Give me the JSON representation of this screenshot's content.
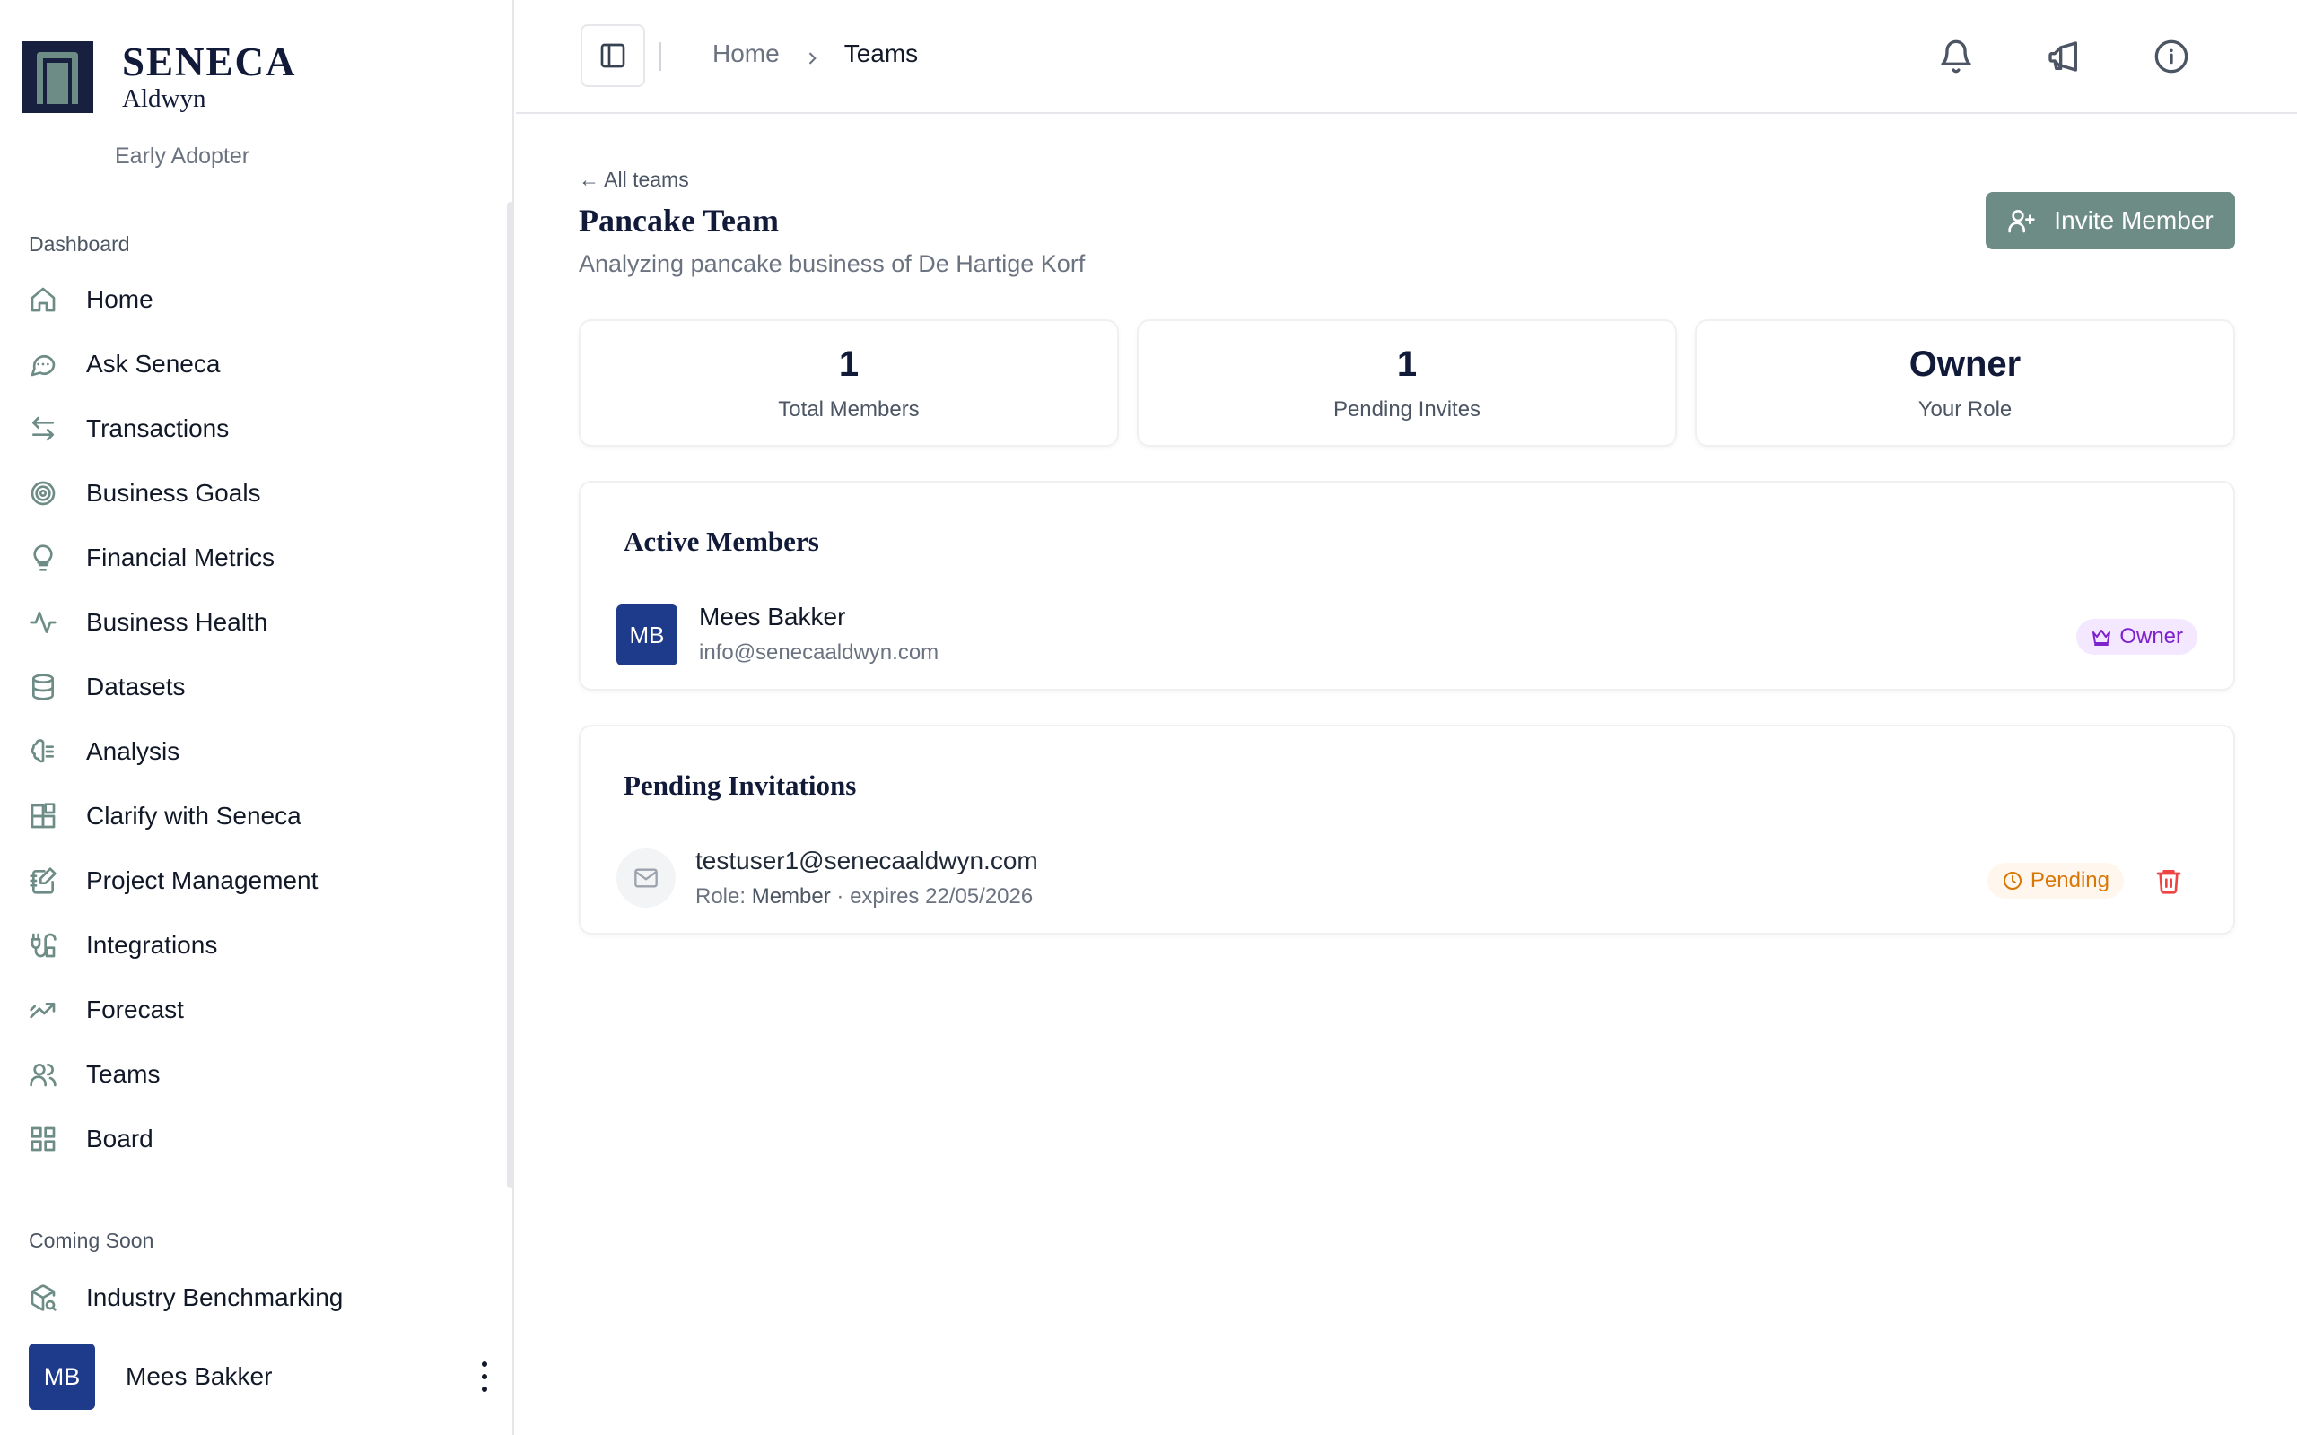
{
  "brand": {
    "title": "SENECA",
    "subtitle": "Aldwyn",
    "plan": "Early Adopter"
  },
  "sidebar": {
    "section_main": "Dashboard",
    "items": [
      {
        "label": "Home",
        "icon": "home-icon"
      },
      {
        "label": "Ask Seneca",
        "icon": "chat-icon"
      },
      {
        "label": "Transactions",
        "icon": "arrows-left-right-icon"
      },
      {
        "label": "Business Goals",
        "icon": "target-icon"
      },
      {
        "label": "Financial Metrics",
        "icon": "lightbulb-icon"
      },
      {
        "label": "Business Health",
        "icon": "activity-icon"
      },
      {
        "label": "Datasets",
        "icon": "database-icon"
      },
      {
        "label": "Analysis",
        "icon": "brain-icon"
      },
      {
        "label": "Clarify with Seneca",
        "icon": "blocks-icon"
      },
      {
        "label": "Project Management",
        "icon": "notebook-pen-icon"
      },
      {
        "label": "Integrations",
        "icon": "plug-icon"
      },
      {
        "label": "Forecast",
        "icon": "trend-up-icon"
      },
      {
        "label": "Teams",
        "icon": "users-icon"
      },
      {
        "label": "Board",
        "icon": "grid-icon"
      }
    ],
    "section_soon": "Coming Soon",
    "soon_items": [
      {
        "label": "Industry Benchmarking",
        "icon": "box-search-icon"
      }
    ],
    "user": {
      "initials": "MB",
      "name": "Mees Bakker"
    }
  },
  "header": {
    "breadcrumb": {
      "home": "Home",
      "current": "Teams"
    }
  },
  "main": {
    "back_link": "← All teams",
    "title": "Pancake Team",
    "subtitle": "Analyzing pancake business of De Hartige Korf",
    "invite_button": "Invite Member",
    "stats": [
      {
        "value": "1",
        "label": "Total Members"
      },
      {
        "value": "1",
        "label": "Pending Invites"
      },
      {
        "value": "Owner",
        "label": "Your Role"
      }
    ],
    "active_members": {
      "title": "Active Members",
      "members": [
        {
          "initials": "MB",
          "name": "Mees Bakker",
          "email": "info@senecaaldwyn.com",
          "role_badge": "Owner"
        }
      ]
    },
    "pending_invitations": {
      "title": "Pending Invitations",
      "invites": [
        {
          "email": "testuser1@senecaaldwyn.com",
          "role_prefix": "Role: ",
          "role": "Member",
          "expires": " · expires 22/05/2026",
          "status": "Pending"
        }
      ]
    }
  },
  "colors": {
    "accent": "#6e8c86",
    "navy": "#111a38",
    "avatar": "#1e3a8a",
    "owner_badge": "#7e22ce",
    "pending_badge": "#d97706",
    "danger": "#ef4444"
  }
}
